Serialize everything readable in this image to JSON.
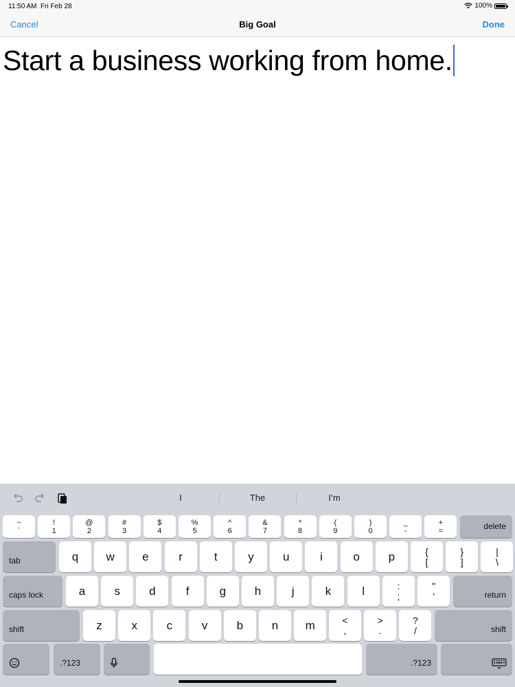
{
  "status_bar": {
    "time": "11:50 AM",
    "date": "Fri Feb 28",
    "wifi_icon": "wifi-icon",
    "battery_percent": "100%",
    "battery_level": 1.0
  },
  "nav": {
    "cancel": "Cancel",
    "title": "Big Goal",
    "done": "Done"
  },
  "editor": {
    "text": "Start a business working from home."
  },
  "keyboard": {
    "toolbar_icons": [
      "undo-icon",
      "redo-icon",
      "paste-icon"
    ],
    "suggestions": [
      "I",
      "The",
      "I’m"
    ],
    "number_row": [
      {
        "top": "~",
        "bottom": "`"
      },
      {
        "top": "!",
        "bottom": "1"
      },
      {
        "top": "@",
        "bottom": "2"
      },
      {
        "top": "#",
        "bottom": "3"
      },
      {
        "top": "$",
        "bottom": "4"
      },
      {
        "top": "%",
        "bottom": "5"
      },
      {
        "top": "^",
        "bottom": "6"
      },
      {
        "top": "&",
        "bottom": "7"
      },
      {
        "top": "*",
        "bottom": "8"
      },
      {
        "top": "(",
        "bottom": "9"
      },
      {
        "top": ")",
        "bottom": "0"
      },
      {
        "top": "_",
        "bottom": "-"
      },
      {
        "top": "+",
        "bottom": "="
      }
    ],
    "delete": "delete",
    "tab": "tab",
    "row_q": [
      "q",
      "w",
      "e",
      "r",
      "t",
      "y",
      "u",
      "i",
      "o",
      "p"
    ],
    "row_q_punct": [
      {
        "top": "{",
        "bottom": "["
      },
      {
        "top": "}",
        "bottom": "]"
      },
      {
        "top": "|",
        "bottom": "\\"
      }
    ],
    "caps_lock": "caps lock",
    "row_a": [
      "a",
      "s",
      "d",
      "f",
      "g",
      "h",
      "j",
      "k",
      "l"
    ],
    "row_a_punct": [
      {
        "top": ":",
        "bottom": ";"
      },
      {
        "top": "\"",
        "bottom": "'"
      }
    ],
    "return": "return",
    "shift": "shift",
    "row_z": [
      "z",
      "x",
      "c",
      "v",
      "b",
      "n",
      "m"
    ],
    "row_z_punct": [
      {
        "top": "<",
        "bottom": ","
      },
      {
        "top": ">",
        "bottom": "."
      },
      {
        "top": "?",
        "bottom": "/"
      }
    ],
    "numbers_key": ".?123",
    "emoji_icon": "emoji-icon",
    "mic_icon": "microphone-icon",
    "dismiss_icon": "keyboard-dismiss-icon"
  }
}
